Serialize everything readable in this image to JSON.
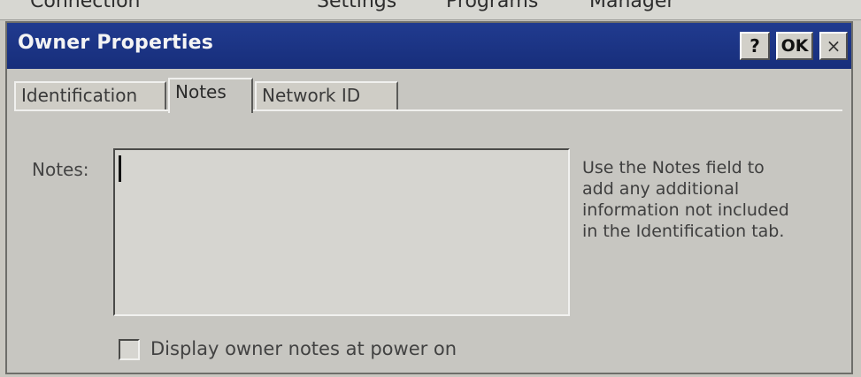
{
  "background_bar": {
    "items": [
      "Connection",
      "Settings",
      "Programs",
      "Manager"
    ]
  },
  "dialog": {
    "title": "Owner Properties",
    "buttons": {
      "help": "?",
      "ok": "OK",
      "close": "×"
    }
  },
  "tabs": [
    {
      "label": "Identification",
      "active": false
    },
    {
      "label": "Notes",
      "active": true
    },
    {
      "label": "Network ID",
      "active": false
    }
  ],
  "notes": {
    "label": "Notes:",
    "value": ""
  },
  "help_text": [
    "Use the Notes field to",
    "add any additional",
    "information not included",
    "in the Identification tab."
  ],
  "checkbox": {
    "label": "Display owner notes at power on",
    "checked": false
  },
  "colors": {
    "title_bar": "#1f3a8c",
    "dialog_bg": "#c7c6c1"
  }
}
